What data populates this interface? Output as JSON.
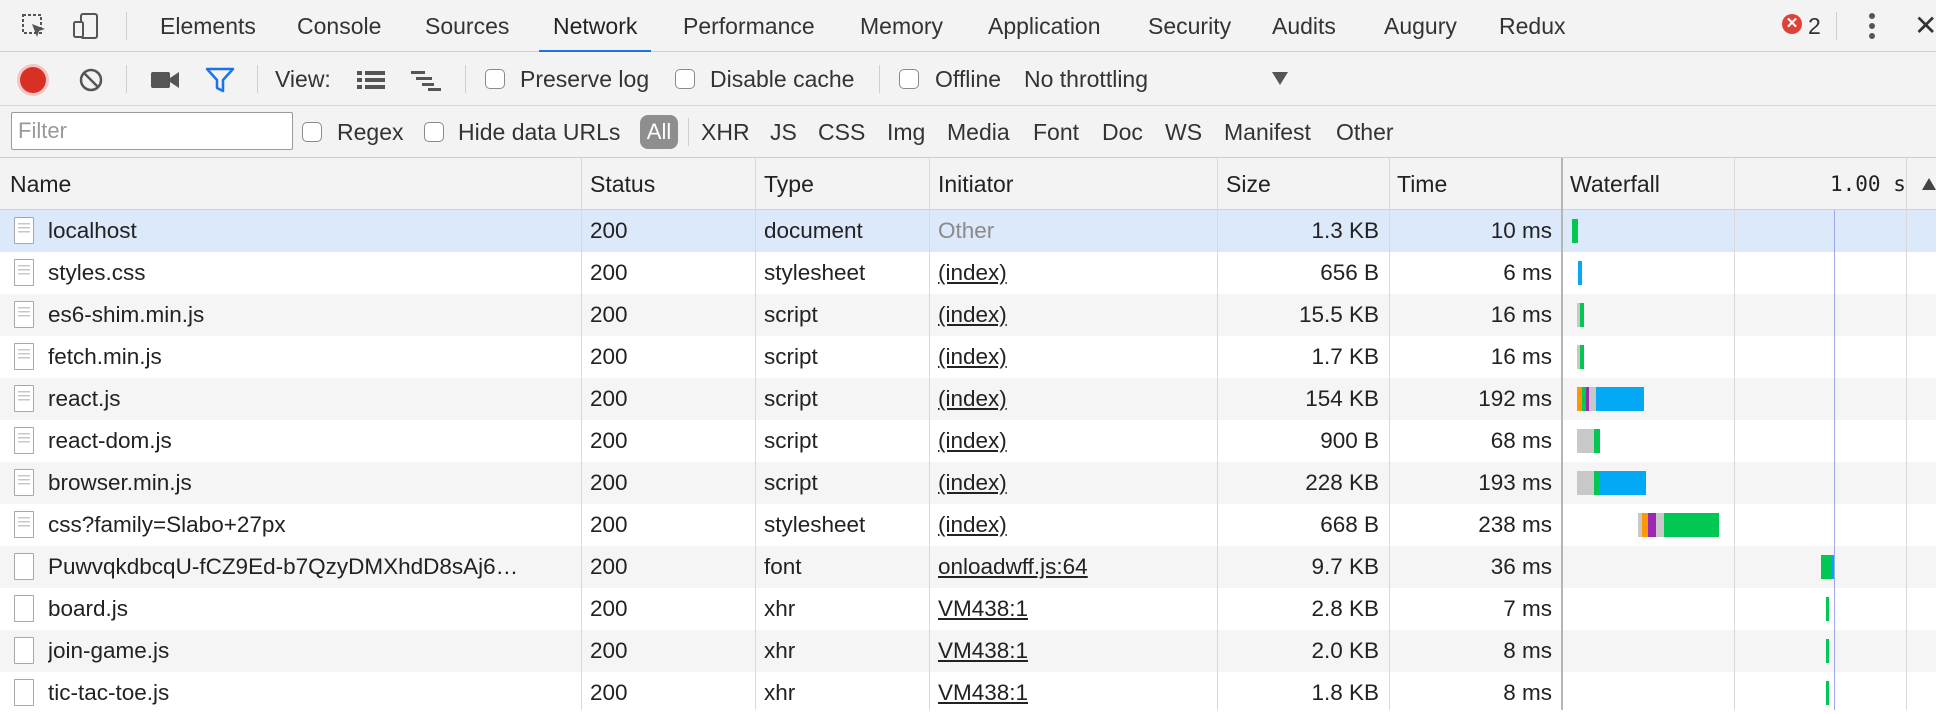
{
  "tabs": [
    "Elements",
    "Console",
    "Sources",
    "Network",
    "Performance",
    "Memory",
    "Application",
    "Security",
    "Audits",
    "Augury",
    "Redux"
  ],
  "active_tab": "Network",
  "error_count": "2",
  "toolbar": {
    "view_label": "View:",
    "preserve_log": "Preserve log",
    "disable_cache": "Disable cache",
    "offline": "Offline",
    "throttling": "No throttling"
  },
  "filter": {
    "placeholder": "Filter",
    "regex": "Regex",
    "hide_data_urls": "Hide data URLs",
    "types": [
      "All",
      "XHR",
      "JS",
      "CSS",
      "Img",
      "Media",
      "Font",
      "Doc",
      "WS",
      "Manifest",
      "Other"
    ],
    "active_type": "All"
  },
  "columns": {
    "name": "Name",
    "status": "Status",
    "type": "Type",
    "initiator": "Initiator",
    "size": "Size",
    "time": "Time",
    "waterfall": "Waterfall",
    "waterfall_time": "1.00 s"
  },
  "rows": [
    {
      "name": "localhost",
      "status": "200",
      "type": "document",
      "initiator": "Other",
      "size": "1.3 KB",
      "time": "10 ms"
    },
    {
      "name": "styles.css",
      "status": "200",
      "type": "stylesheet",
      "initiator": "(index)",
      "size": "656 B",
      "time": "6 ms"
    },
    {
      "name": "es6-shim.min.js",
      "status": "200",
      "type": "script",
      "initiator": "(index)",
      "size": "15.5 KB",
      "time": "16 ms"
    },
    {
      "name": "fetch.min.js",
      "status": "200",
      "type": "script",
      "initiator": "(index)",
      "size": "1.7 KB",
      "time": "16 ms"
    },
    {
      "name": "react.js",
      "status": "200",
      "type": "script",
      "initiator": "(index)",
      "size": "154 KB",
      "time": "192 ms"
    },
    {
      "name": "react-dom.js",
      "status": "200",
      "type": "script",
      "initiator": "(index)",
      "size": "900 B",
      "time": "68 ms"
    },
    {
      "name": "browser.min.js",
      "status": "200",
      "type": "script",
      "initiator": "(index)",
      "size": "228 KB",
      "time": "193 ms"
    },
    {
      "name": "css?family=Slabo+27px",
      "status": "200",
      "type": "stylesheet",
      "initiator": "(index)",
      "size": "668 B",
      "time": "238 ms"
    },
    {
      "name": "PuwvqkdbcqU-fCZ9Ed-b7QzyDMXhdD8sAj6…",
      "status": "200",
      "type": "font",
      "initiator": "onloadwff.js:64",
      "size": "9.7 KB",
      "time": "36 ms"
    },
    {
      "name": "board.js",
      "status": "200",
      "type": "xhr",
      "initiator": "VM438:1",
      "size": "2.8 KB",
      "time": "7 ms"
    },
    {
      "name": "join-game.js",
      "status": "200",
      "type": "xhr",
      "initiator": "VM438:1",
      "size": "2.0 KB",
      "time": "8 ms"
    },
    {
      "name": "tic-tac-toe.js",
      "status": "200",
      "type": "xhr",
      "initiator": "VM438:1",
      "size": "1.8 KB",
      "time": "8 ms"
    }
  ],
  "colors": {
    "accent": "#1a73e8",
    "record": "#d93025",
    "filter_icon": "#1a73e8",
    "selected_row": "#dbe9fb",
    "wf_waiting": "#c8c8c8",
    "wf_ttfb": "#00c853",
    "wf_download": "#03a9f4",
    "wf_dns": "#ff9800",
    "wf_ssl": "#9c27b0"
  }
}
